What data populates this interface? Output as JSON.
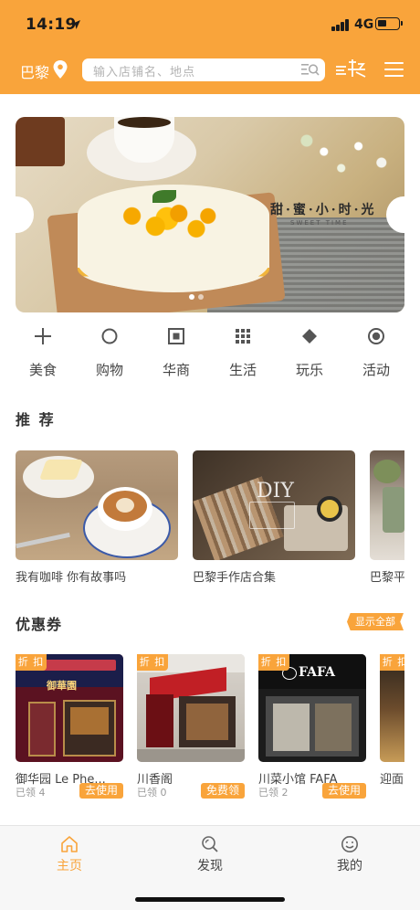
{
  "status_bar": {
    "time": "14:19",
    "network": "4G"
  },
  "header": {
    "city": "巴黎",
    "search_placeholder": "输入店铺名、地点"
  },
  "banner": {
    "title_cn": "甜·蜜·小·时·光",
    "title_en": "SWEET TIME"
  },
  "categories": [
    {
      "label": "美食",
      "icon": "plus-icon"
    },
    {
      "label": "购物",
      "icon": "circle-icon"
    },
    {
      "label": "华商",
      "icon": "square-dot-icon"
    },
    {
      "label": "生活",
      "icon": "grid-icon"
    },
    {
      "label": "玩乐",
      "icon": "diamond-icon"
    },
    {
      "label": "活动",
      "icon": "target-icon"
    }
  ],
  "recommend": {
    "title": "推 荐",
    "items": [
      {
        "caption": "我有咖啡 你有故事吗",
        "image_text": ""
      },
      {
        "caption": "巴黎手作店合集",
        "image_text": "DIY"
      },
      {
        "caption": "巴黎平",
        "image_text": ""
      }
    ]
  },
  "coupons": {
    "title": "优惠券",
    "show_all": "显示全部",
    "tag": "折 扣",
    "items": [
      {
        "name": "御华园 Le Phe...",
        "claimed": "已领 4",
        "action": "去使用",
        "sign": "御華園"
      },
      {
        "name": "川香阁",
        "claimed": "已领 0",
        "action": "免费领",
        "sign": ""
      },
      {
        "name": "川菜小馆 FAFA",
        "claimed": "已领 2",
        "action": "去使用",
        "sign": "FAFA"
      },
      {
        "name": "迎面",
        "claimed": "已领",
        "action": "",
        "sign": ""
      }
    ]
  },
  "tabbar": {
    "items": [
      {
        "label": "主页",
        "icon": "home-icon",
        "active": true
      },
      {
        "label": "发现",
        "icon": "discover-icon",
        "active": false
      },
      {
        "label": "我的",
        "icon": "profile-icon",
        "active": false
      }
    ]
  },
  "colors": {
    "accent": "#f9a43b",
    "text": "#333333",
    "muted": "#999999"
  }
}
